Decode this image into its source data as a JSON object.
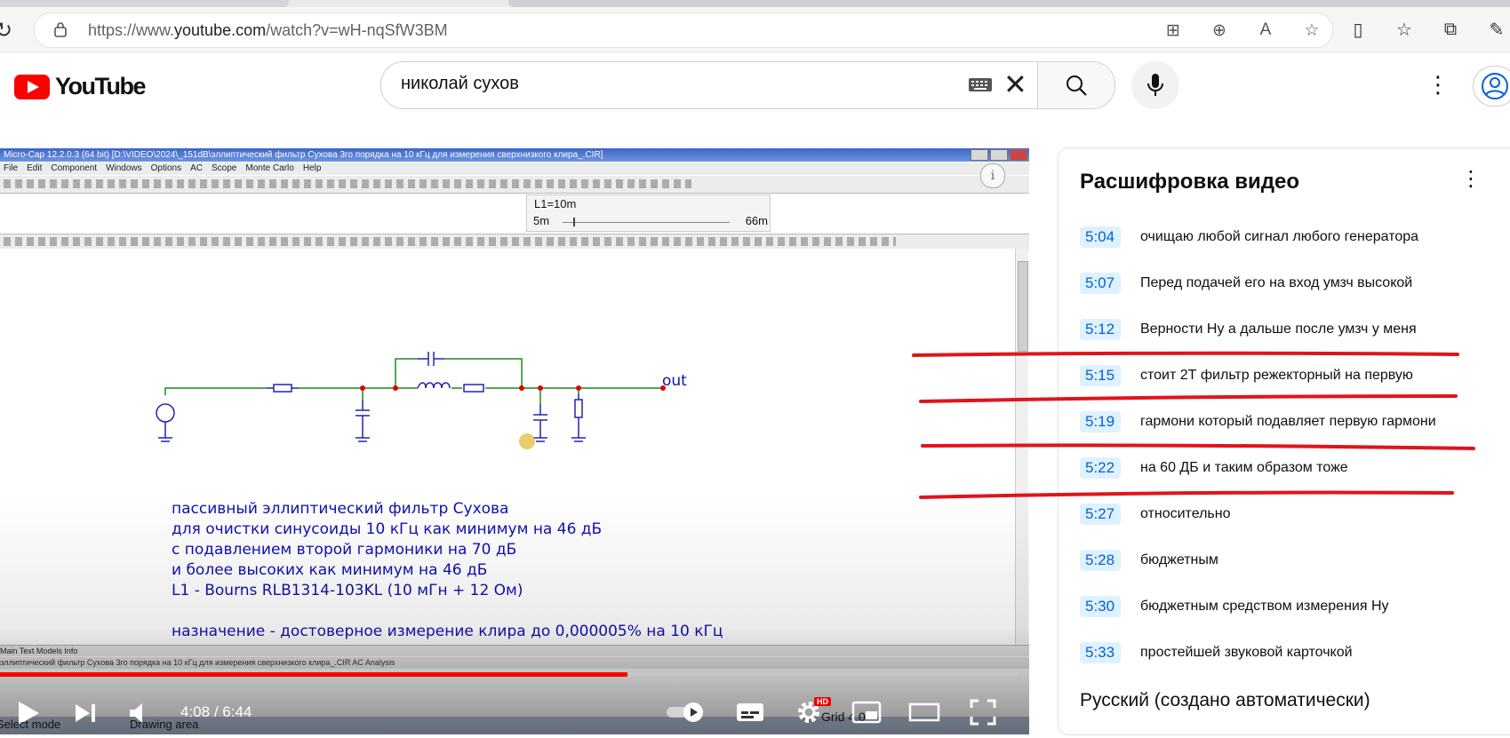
{
  "browser": {
    "url_prefix": "https://www.",
    "url_domain": "youtube.com",
    "url_path": "/watch?v=wH-nqSfW3BM"
  },
  "youtube": {
    "logo_text": "YouTube",
    "search_query": "николай сухов"
  },
  "video": {
    "app_title": "Micro-Cap 12.2.0.3 (64 bit)   [D:\\VIDEO\\2024\\_151dB\\эллиптический фильтр Сухова 3го порядка на 10 кГц для измерения сверхнизкого клира_.CIR]",
    "menu": [
      "File",
      "Edit",
      "Component",
      "Windows",
      "Options",
      "AC",
      "Scope",
      "Monte Carlo",
      "Help"
    ],
    "slider": {
      "label": "L1=10m",
      "min": "5m",
      "max": "66m"
    },
    "node_label": "out",
    "annotation_lines": [
      "пассивный эллиптический фильтр Сухова",
      "для очистки синусоиды 10 кГц как минимум на 46 дБ",
      "с подавлением второй гармоники на 70 дБ",
      "и более высоких как минимум на 46 дБ",
      "L1 - Bourns RLB1314-103KL (10 мГн + 12 Ом)",
      "",
      "назначение - достоверное измерение клира до 0,000005% на 10 кГц"
    ],
    "sheet_tabs": "Main  Text  Models  Info",
    "status_text": "эллиптический фильтр Сухова 3го порядка на 10 кГц для измерения сверхнизкого клира_.CIR   AC Analysis",
    "status_mode": "Select mode",
    "status_drawing": "Drawing area",
    "status_grid": "Grid 4.0",
    "time_current": "4:08",
    "time_separator": " / ",
    "time_total": "6:44",
    "progress_fraction": 0.617,
    "hd_badge": "HD"
  },
  "transcript": {
    "title": "Расшифровка видео",
    "segments": [
      {
        "time": "5:04",
        "text": "очищаю любой сигнал любого генератора"
      },
      {
        "time": "5:07",
        "text": "Перед подачей его на вход умзч высокой"
      },
      {
        "time": "5:12",
        "text": "Верности Ну а дальше после умзч у меня"
      },
      {
        "time": "5:15",
        "text": "стоит 2Т фильтр режекторный на первую"
      },
      {
        "time": "5:19",
        "text": "гармони который подавляет первую гармони"
      },
      {
        "time": "5:22",
        "text": "на 60 ДБ и таким образом тоже"
      },
      {
        "time": "5:27",
        "text": "относительно"
      },
      {
        "time": "5:28",
        "text": "бюджетным"
      },
      {
        "time": "5:30",
        "text": "бюджетным средством измерения Ну"
      },
      {
        "time": "5:33",
        "text": "простейшей звуковой карточкой"
      }
    ],
    "language": "Русский (создано автоматически)"
  },
  "colors": {
    "accent_red": "#ff0000",
    "timestamp_bg": "#def1ff",
    "timestamp_fg": "#065fd4",
    "wire_green": "#1a8a1a",
    "component_blue": "#2323b0",
    "annotation_blue": "#1010b0"
  }
}
